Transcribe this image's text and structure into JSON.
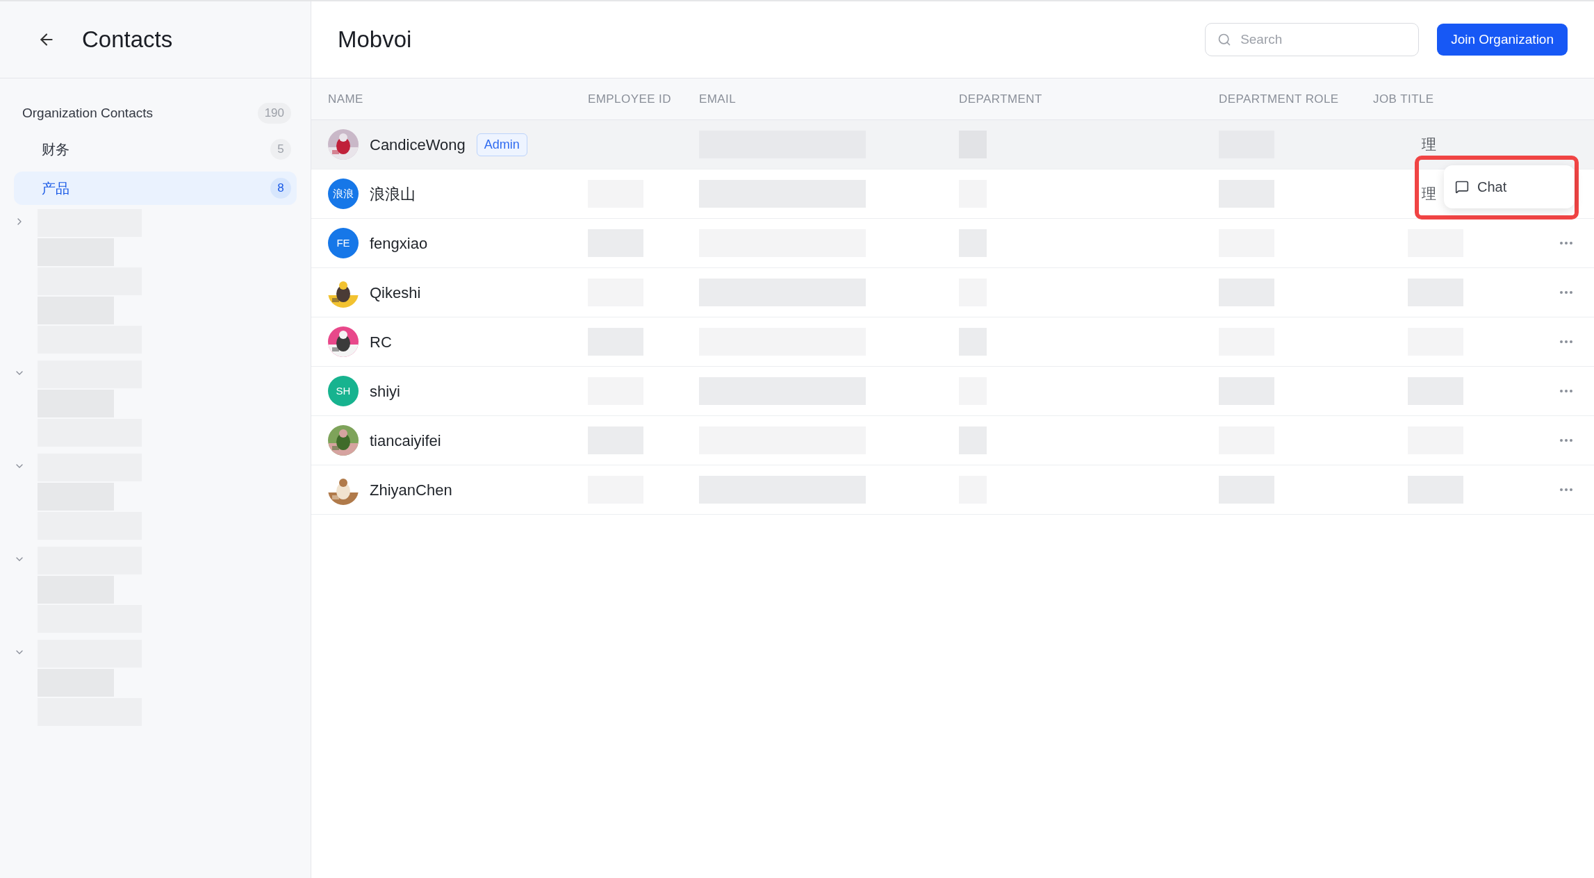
{
  "sidebar": {
    "title": "Contacts",
    "organization": {
      "label": "Organization Contacts",
      "count": "190",
      "children": [
        {
          "label": "财务",
          "count": "5",
          "selected": false
        },
        {
          "label": "产品",
          "count": "8",
          "selected": true
        }
      ]
    },
    "tree_sections": [
      {
        "expanded": false
      },
      {
        "expanded": true
      },
      {
        "expanded": true
      },
      {
        "expanded": true
      },
      {
        "expanded": true
      }
    ]
  },
  "header": {
    "title": "Mobvoi",
    "search": {
      "placeholder": "Search"
    },
    "join_button": "Join Organization"
  },
  "table": {
    "columns": [
      "NAME",
      "EMPLOYEE ID",
      "EMAIL",
      "DEPARTMENT",
      "DEPARTMENT ROLE",
      "JOB TITLE"
    ],
    "rows": [
      {
        "name": "CandiceWong",
        "badge": "Admin",
        "job_title": "理",
        "hovered": true
      },
      {
        "name": "浪浪山",
        "avatar": {
          "kind": "initials",
          "initials": "浪浪",
          "color": "#1677e8"
        },
        "job_title": "理",
        "hovered": false
      },
      {
        "name": "fengxiao",
        "avatar": {
          "kind": "initials",
          "initials": "FE",
          "color": "#1677e8"
        },
        "hovered": false,
        "actions": true
      },
      {
        "name": "Qikeshi",
        "hovered": false,
        "actions": true
      },
      {
        "name": "RC",
        "hovered": false,
        "actions": true
      },
      {
        "name": "shiyi",
        "avatar": {
          "kind": "initials",
          "initials": "SH",
          "color": "#17b38f"
        },
        "hovered": false,
        "actions": true
      },
      {
        "name": "tiancaiyifei",
        "hovered": false,
        "actions": true
      },
      {
        "name": "ZhiyanChen",
        "hovered": false,
        "actions": true
      }
    ]
  },
  "context_menu": {
    "items": [
      {
        "label": "Chat"
      }
    ],
    "highlighted": true
  }
}
